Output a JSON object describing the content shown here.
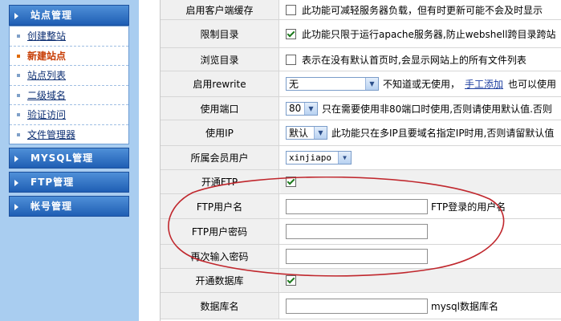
{
  "sidebar": {
    "site_panel": "站点管理",
    "items": [
      "创建整站",
      "新建站点",
      "站点列表",
      "二级域名",
      "验证访问",
      "文件管理器"
    ],
    "active_index": 1,
    "mysql_panel": "MYSQL管理",
    "ftp_panel": "FTP管理",
    "account_panel": "帐号管理"
  },
  "form": {
    "client_cache": {
      "label": "启用客户端缓存",
      "checked": false,
      "desc": "此功能可减轻服务器负载，但有时更新可能不会及时显示"
    },
    "restrict_dir": {
      "label": "限制目录",
      "checked": true,
      "desc": "此功能只限于运行apache服务器,防止webshell跨目录跨站"
    },
    "browse_dir": {
      "label": "浏览目录",
      "checked": false,
      "desc": "表示在没有默认首页时,会显示网站上的所有文件列表"
    },
    "rewrite": {
      "label": "启用rewrite",
      "selected": "无",
      "desc_before": "不知道或无使用，",
      "link": "手工添加",
      "desc_after": "也可以使用"
    },
    "port": {
      "label": "使用端口",
      "selected": "80",
      "desc": "只在需要使用非80端口时使用,否则请使用默认值.否则"
    },
    "ip": {
      "label": "使用IP",
      "selected": "默认",
      "desc": "此功能只在多IP且要域名指定IP时用,否则请留默认值"
    },
    "member": {
      "label": "所属会员用户",
      "selected": "xinjiapo"
    },
    "enable_ftp": {
      "label": "开通FTP",
      "checked": true
    },
    "ftp_user": {
      "label": "FTP用户名",
      "hint": "FTP登录的用户名"
    },
    "ftp_pass": {
      "label": "FTP用户密码"
    },
    "ftp_pass2": {
      "label": "再次输入密码"
    },
    "enable_db": {
      "label": "开通数据库",
      "checked": true
    },
    "db_name": {
      "label": "数据库名",
      "hint": "mysql数据库名"
    }
  },
  "colors": {
    "sidebar_bg": "#a9cdf0",
    "panel_head": "#2a6cc2",
    "annotation": "#c0272d",
    "active_item": "#c63a00"
  }
}
